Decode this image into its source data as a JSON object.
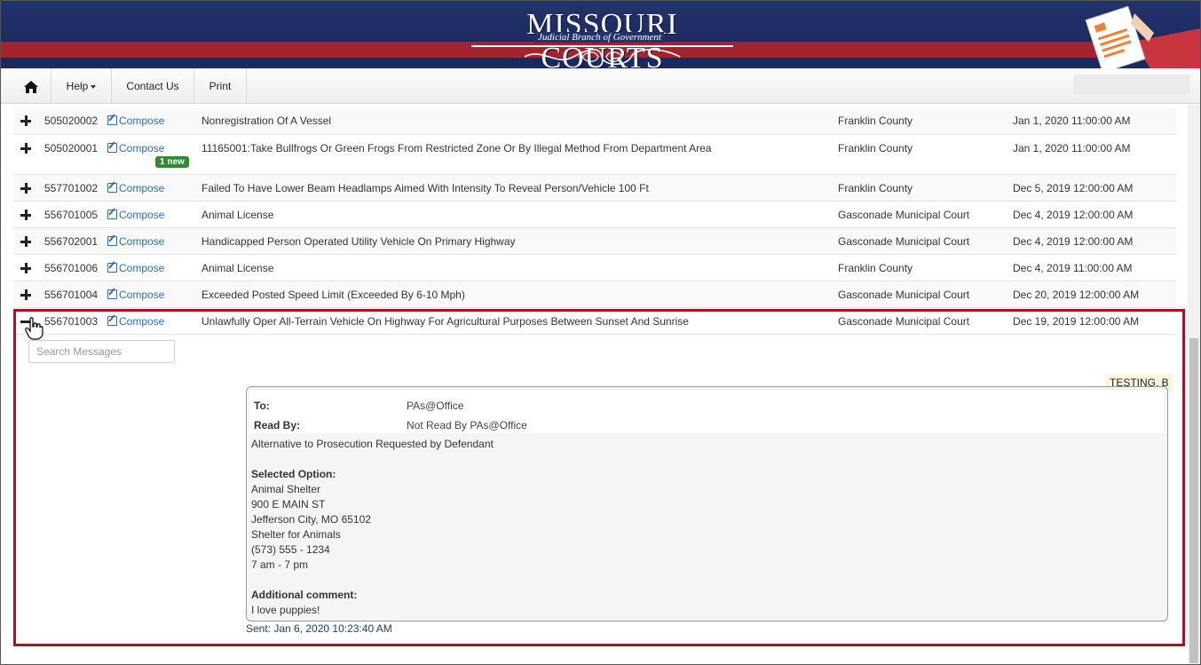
{
  "header": {
    "logo_title": "MISSOURI COURTS",
    "logo_subtitle": "Judicial Branch of Government"
  },
  "nav": {
    "help_label": "Help",
    "contact_label": "Contact Us",
    "print_label": "Print"
  },
  "rows": [
    {
      "id": "505020002",
      "compose": "Compose",
      "desc": "Nonregistration Of A Vessel",
      "court": "Franklin County",
      "date": "Jan 1, 2020 11:00:00 AM"
    },
    {
      "id": "505020001",
      "compose": "Compose",
      "desc": "11165001:Take Bullfrogs Or Green Frogs From Restricted Zone Or By Illegal Method From Department Area",
      "court": "Franklin County",
      "date": "Jan 1, 2020 11:00:00 AM",
      "badge": "1 new"
    },
    {
      "id": "557701002",
      "compose": "Compose",
      "desc": "Failed To Have Lower Beam Headlamps Aimed With Intensity To Reveal Person/Vehicle 100 Ft",
      "court": "Franklin County",
      "date": "Dec 5, 2019 12:00:00 AM"
    },
    {
      "id": "556701005",
      "compose": "Compose",
      "desc": "Animal License",
      "court": "Gasconade Municipal Court",
      "date": "Dec 4, 2019 12:00:00 AM"
    },
    {
      "id": "556702001",
      "compose": "Compose",
      "desc": "Handicapped Person Operated Utility Vehicle On Primary Highway",
      "court": "Gasconade Municipal Court",
      "date": "Dec 4, 2019 12:00:00 AM"
    },
    {
      "id": "556701006",
      "compose": "Compose",
      "desc": "Animal License",
      "court": "Franklin County",
      "date": "Dec 4, 2019 11:00:00 AM"
    },
    {
      "id": "556701004",
      "compose": "Compose",
      "desc": "Exceeded Posted Speed Limit (Exceeded By 6-10 Mph)",
      "court": "Gasconade Municipal Court",
      "date": "Dec 20, 2019 12:00:00 AM"
    },
    {
      "id": "556701003",
      "compose": "Compose",
      "desc": "Unlawfully Oper All-Terrain Vehicle On Highway For Agricultural Purposes Between Sunset And Sunrise",
      "court": "Gasconade Municipal Court",
      "date": "Dec 19, 2019 12:00:00 AM"
    }
  ],
  "search": {
    "placeholder": "Search Messages"
  },
  "message": {
    "sender": "TESTING, B",
    "to_label": "To:",
    "to_value": "PAs@Office",
    "read_by_label": "Read By:",
    "read_by_value": "Not Read By PAs@Office",
    "intro": "Alternative to Prosecution Requested by Defendant",
    "selected_option_label": "Selected Option:",
    "option_lines": [
      "Animal Shelter",
      "900 E MAIN ST",
      "Jefferson City, MO 65102",
      "Shelter for Animals",
      "(573) 555 - 1234",
      "7 am - 7 pm"
    ],
    "additional_comment_label": "Additional comment:",
    "comment": "I love puppies!",
    "sent": "Sent: Jan 6, 2020 10:23:40 AM"
  }
}
